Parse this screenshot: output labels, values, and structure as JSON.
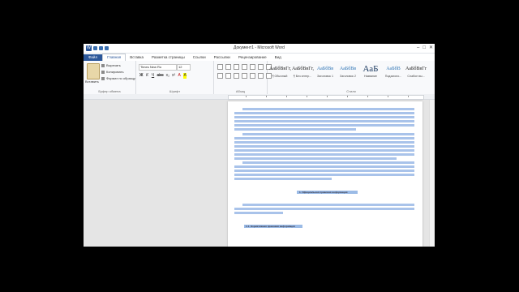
{
  "window": {
    "title": "Документ1 - Microsoft Word"
  },
  "tabs": [
    "Файл",
    "Главная",
    "Вставка",
    "Разметка страницы",
    "Ссылки",
    "Рассылки",
    "Рецензирование",
    "Вид"
  ],
  "ribbon": {
    "clipboard": {
      "paste": "Вставить",
      "cut": "Вырезать",
      "copy": "Копировать",
      "format": "Формат по образцу",
      "label": "Буфер обмена"
    },
    "font": {
      "name": "Times New Ro",
      "size": "12",
      "label": "Шрифт",
      "buttons": [
        "Ж",
        "К",
        "Ч",
        "abc",
        "x₂",
        "x²",
        "A",
        "A"
      ]
    },
    "paragraph": {
      "label": "Абзац"
    },
    "styles": {
      "label": "Стили",
      "items": [
        {
          "preview": "АаБбВвГг,",
          "name": "¶ Обычный"
        },
        {
          "preview": "АаБбВвГг,",
          "name": "¶ Без интер..."
        },
        {
          "preview": "АаБбВв",
          "name": "Заголовок 1"
        },
        {
          "preview": "АаБбВв",
          "name": "Заголовок 2"
        },
        {
          "preview": "АаБ",
          "name": "Название"
        },
        {
          "preview": "АаБбВ",
          "name": "Подзаголо..."
        },
        {
          "preview": "АаБбВвГг",
          "name": "Слабое вы..."
        }
      ]
    }
  },
  "document": {
    "heading1": "1. Официальная правовая информация",
    "heading2": "1.1. Нормативная правовая информация"
  }
}
